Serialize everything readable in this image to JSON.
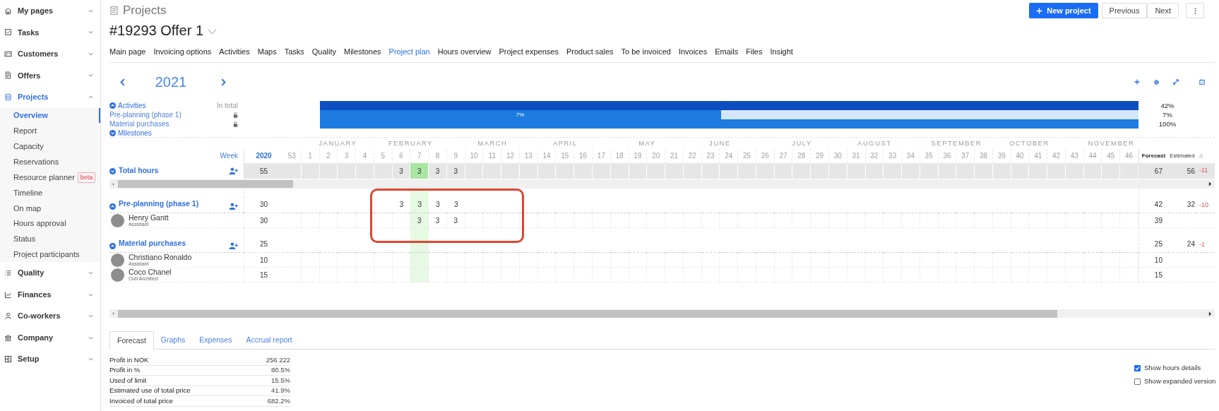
{
  "sidebar": {
    "items": [
      {
        "label": "My pages",
        "expanded": false,
        "selected": false
      },
      {
        "label": "Tasks",
        "expanded": false,
        "selected": false
      },
      {
        "label": "Customers",
        "expanded": false,
        "selected": false
      },
      {
        "label": "Offers",
        "expanded": false,
        "selected": false
      },
      {
        "label": "Projects",
        "expanded": true,
        "selected": true,
        "children": [
          {
            "label": "Overview",
            "selected": true
          },
          {
            "label": "Report",
            "selected": false
          },
          {
            "label": "Capacity",
            "selected": false
          },
          {
            "label": "Reservations",
            "selected": false
          },
          {
            "label": "Resource planner",
            "selected": false,
            "badge": "beta"
          },
          {
            "label": "Timeline",
            "selected": false
          },
          {
            "label": "On map",
            "selected": false
          },
          {
            "label": "Hours approval",
            "selected": false
          },
          {
            "label": "Status",
            "selected": false
          },
          {
            "label": "Project participants",
            "selected": false
          }
        ]
      },
      {
        "label": "Quality",
        "expanded": false,
        "selected": false
      },
      {
        "label": "Finances",
        "expanded": false,
        "selected": false
      },
      {
        "label": "Co-workers",
        "expanded": false,
        "selected": false
      },
      {
        "label": "Company",
        "expanded": false,
        "selected": false
      },
      {
        "label": "Setup",
        "expanded": false,
        "selected": false
      }
    ]
  },
  "header": {
    "section": "Projects",
    "title": "#19293 Offer 1",
    "buttons": [
      {
        "kind": "primary",
        "label": "New project"
      },
      {
        "kind": "secondary",
        "label": "Previous"
      },
      {
        "kind": "secondary",
        "label": "Next"
      },
      {
        "kind": "more"
      }
    ]
  },
  "tabs": [
    {
      "label": "Main page",
      "selected": false
    },
    {
      "label": "Invoicing options",
      "selected": false
    },
    {
      "label": "Activities",
      "selected": false
    },
    {
      "label": "Maps",
      "selected": false
    },
    {
      "label": "Tasks",
      "selected": false
    },
    {
      "label": "Quality",
      "selected": false
    },
    {
      "label": "Milestones",
      "selected": false
    },
    {
      "label": "Project plan",
      "selected": true
    },
    {
      "label": "Hours overview",
      "selected": false
    },
    {
      "label": "Project expenses",
      "selected": false
    },
    {
      "label": "Product sales",
      "selected": false
    },
    {
      "label": "To be invoiced",
      "selected": false
    },
    {
      "label": "Invoices",
      "selected": false
    },
    {
      "label": "Emails",
      "selected": false
    },
    {
      "label": "Files",
      "selected": false
    },
    {
      "label": "Insight",
      "selected": false
    }
  ],
  "plan": {
    "year": "2021",
    "legend": [
      {
        "kind": "section",
        "label": "Activities",
        "expanded": true,
        "note": "In total"
      },
      {
        "kind": "activity",
        "label": "Pre-planning (phase 1)"
      },
      {
        "kind": "activity",
        "label": "Material purchases"
      },
      {
        "kind": "section",
        "label": "Milestones",
        "expanded": false
      }
    ],
    "bars": [
      {
        "color": "#0d4fbf",
        "total": "42%"
      },
      {
        "level": 0.49,
        "color": "#1e7be0",
        "label": "7%",
        "total": "7%"
      },
      {
        "color": "#1e7be0",
        "total": "100%"
      }
    ],
    "months": [
      {
        "label": "JANUARY"
      },
      {
        "label": "FEBRUARY"
      },
      {
        "label": "MARCH"
      },
      {
        "label": "APRIL"
      },
      {
        "label": "MAY"
      },
      {
        "label": "JUNE"
      },
      {
        "label": "JULY"
      },
      {
        "label": "AUGUST"
      },
      {
        "label": "SEPTEMBER"
      },
      {
        "label": "OCTOBER"
      },
      {
        "label": "NOVEMBER"
      }
    ],
    "week_label": "Week",
    "year_column": "2020",
    "weeks": [
      {
        "label": "53",
        "selected": false
      },
      {
        "label": "1",
        "selected": false
      },
      {
        "label": "2",
        "selected": false
      },
      {
        "label": "3",
        "selected": false
      },
      {
        "label": "4",
        "selected": false
      },
      {
        "label": "5",
        "selected": false
      },
      {
        "label": "6",
        "selected": false
      },
      {
        "label": "7",
        "selected": true
      },
      {
        "label": "8",
        "selected": false
      },
      {
        "label": "9",
        "selected": false
      },
      {
        "label": "10",
        "selected": false
      },
      {
        "label": "11",
        "selected": false
      },
      {
        "label": "12",
        "selected": false
      },
      {
        "label": "13",
        "selected": false
      },
      {
        "label": "14",
        "selected": false
      },
      {
        "label": "15",
        "selected": false
      },
      {
        "label": "16",
        "selected": false
      },
      {
        "label": "17",
        "selected": false
      },
      {
        "label": "18",
        "selected": false
      },
      {
        "label": "19",
        "selected": false
      },
      {
        "label": "20",
        "selected": false
      },
      {
        "label": "21",
        "selected": false
      },
      {
        "label": "22",
        "selected": false
      },
      {
        "label": "23",
        "selected": false
      },
      {
        "label": "24",
        "selected": false
      },
      {
        "label": "25",
        "selected": false
      },
      {
        "label": "26",
        "selected": false
      },
      {
        "label": "27",
        "selected": false
      },
      {
        "label": "28",
        "selected": false
      },
      {
        "label": "29",
        "selected": false
      },
      {
        "label": "30",
        "selected": false
      },
      {
        "label": "31",
        "selected": false
      },
      {
        "label": "32",
        "selected": false
      },
      {
        "label": "33",
        "selected": false
      },
      {
        "label": "34",
        "selected": false
      },
      {
        "label": "35",
        "selected": false
      },
      {
        "label": "36",
        "selected": false
      },
      {
        "label": "37",
        "selected": false
      },
      {
        "label": "38",
        "selected": false
      },
      {
        "label": "39",
        "selected": false
      },
      {
        "label": "40",
        "selected": false
      },
      {
        "label": "41",
        "selected": false
      },
      {
        "label": "42",
        "selected": false
      },
      {
        "label": "43",
        "selected": false
      },
      {
        "label": "44",
        "selected": false
      },
      {
        "label": "45",
        "selected": false
      },
      {
        "label": "46",
        "selected": false
      }
    ],
    "summary_columns": [
      "Forecast",
      "Estimated",
      "Δ"
    ],
    "rows": [
      {
        "kind": "total",
        "label": "Total hours",
        "expanded": false,
        "total": "55",
        "hours": [
          "3",
          "3",
          "3",
          "3"
        ],
        "forecast": "67",
        "estimated": "56",
        "difference": "-11"
      },
      {
        "kind": "group",
        "label": "Pre-planning (phase 1)",
        "expanded": true,
        "total": "30",
        "hours": [
          "3",
          "3",
          "3",
          "3"
        ],
        "forecast": "42",
        "estimated": "32",
        "difference": "-10"
      },
      {
        "kind": "person",
        "label": "Henry Gantt",
        "role": "Assistant",
        "total": "30",
        "hours": [
          "3",
          "3",
          "3"
        ],
        "forecast": "39"
      },
      {
        "kind": "group",
        "label": "Material purchases",
        "expanded": true,
        "total": "25",
        "forecast": "25",
        "estimated": "24",
        "difference": "-1"
      },
      {
        "kind": "person",
        "label": "Christiano Ronaldo",
        "role": "Assistant",
        "total": "10",
        "forecast": "10"
      },
      {
        "kind": "person",
        "label": "Coco Chanel",
        "role": "Civil Architect",
        "total": "15",
        "forecast": "15"
      }
    ]
  },
  "bottom_tabs": [
    {
      "label": "Forecast",
      "selected": true
    },
    {
      "label": "Graphs",
      "selected": false
    },
    {
      "label": "Expenses",
      "selected": false
    },
    {
      "label": "Accrual report",
      "selected": false
    }
  ],
  "forecast_table": [
    {
      "label": "Profit in NOK",
      "value": "256 222"
    },
    {
      "label": "Profit in %",
      "value": "80.5%"
    },
    {
      "label": "Used of limit",
      "value": "15.5%"
    },
    {
      "label": "Estimated use of total price",
      "value": "41.9%"
    },
    {
      "label": "Invoiced of total price",
      "value": "682.2%"
    }
  ],
  "options": [
    {
      "label": "Show hours details",
      "checked": true
    },
    {
      "label": "Show expanded version",
      "checked": false
    }
  ]
}
